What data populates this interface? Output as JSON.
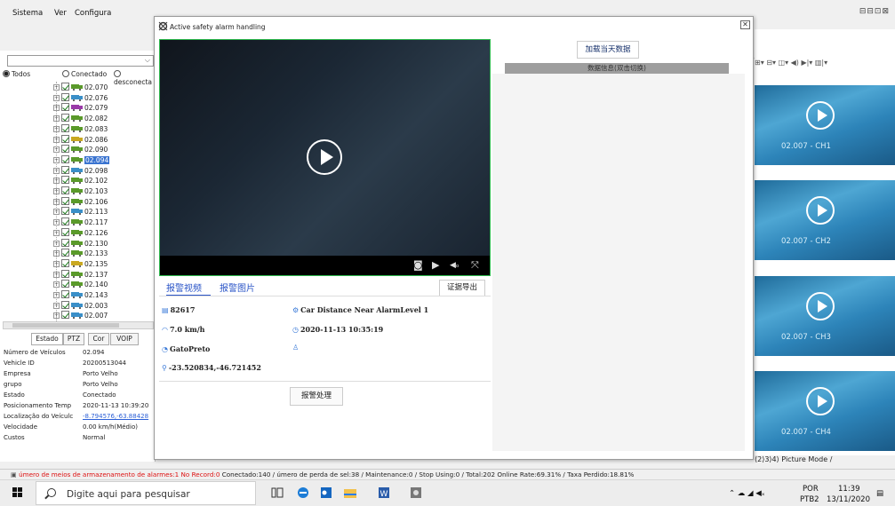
{
  "menubar": {
    "items": [
      "Sistema",
      "Ver",
      "Configura"
    ]
  },
  "filter": {
    "radio_all": "Todos",
    "radio_connected": "Conectado",
    "radio_disconnected": "desconecta"
  },
  "tree": {
    "items": [
      {
        "label": "02.070",
        "color": "#5a9a2a"
      },
      {
        "label": "02.076",
        "color": "#3a8fc8"
      },
      {
        "label": "02.079",
        "color": "#9a3aa8"
      },
      {
        "label": "02.082",
        "color": "#5a9a2a"
      },
      {
        "label": "02.083",
        "color": "#5a9a2a"
      },
      {
        "label": "02.086",
        "color": "#c9a820"
      },
      {
        "label": "02.090",
        "color": "#5a9a2a"
      },
      {
        "label": "02.094",
        "color": "#5a9a2a",
        "selected": true
      },
      {
        "label": "02.098",
        "color": "#3a8fc8"
      },
      {
        "label": "02.102",
        "color": "#5a9a2a"
      },
      {
        "label": "02.103",
        "color": "#5a9a2a"
      },
      {
        "label": "02.106",
        "color": "#5a9a2a"
      },
      {
        "label": "02.113",
        "color": "#3a8fc8"
      },
      {
        "label": "02.117",
        "color": "#5a9a2a"
      },
      {
        "label": "02.126",
        "color": "#5a9a2a"
      },
      {
        "label": "02.130",
        "color": "#5a9a2a"
      },
      {
        "label": "02.133",
        "color": "#5a9a2a"
      },
      {
        "label": "02.135",
        "color": "#c9a820"
      },
      {
        "label": "02.137",
        "color": "#5a9a2a"
      },
      {
        "label": "02.140",
        "color": "#5a9a2a"
      },
      {
        "label": "02.143",
        "color": "#3a8fc8"
      },
      {
        "label": "02.003",
        "color": "#3a8fc8"
      },
      {
        "label": "02.007",
        "color": "#3a8fc8"
      }
    ]
  },
  "tabs": [
    "Estado",
    "PTZ",
    "Cor",
    "VOIP"
  ],
  "props": [
    {
      "k": "Número de Veículos",
      "v": "02.094"
    },
    {
      "k": "Vehicle ID",
      "v": "20200513044"
    },
    {
      "k": "Empresa",
      "v": "Porto Velho"
    },
    {
      "k": "grupo",
      "v": "Porto Velho"
    },
    {
      "k": "Estado",
      "v": "Conectado"
    },
    {
      "k": "Posicionamento Temp",
      "v": "2020-11-13 10:39:20"
    },
    {
      "k": "Localização do Veículc",
      "v": "-8.794576,-63.88428"
    },
    {
      "k": "Velocidade",
      "v": "0.00 km/h(Médio)"
    },
    {
      "k": "Custos",
      "v": "Normal"
    }
  ],
  "dialog": {
    "title": "Active safety alarm handling",
    "tab_video": "报警视频",
    "tab_image": "报警图片",
    "export": "证据导出",
    "plate": "82617",
    "alarm": "Car Distance Near AlarmLevel 1",
    "speed": "7.0 km/h",
    "time": "2020-11-13 10:35:19",
    "driver": "GatoPreto",
    "coords": "-23.520834,-46.721452",
    "handle": "报警处理",
    "load_today": "加载当天数据",
    "data_header": "数据信息(双击切换)"
  },
  "channels": [
    "02.007 - CH1",
    "02.007 - CH2",
    "02.007 - CH3",
    "02.007 - CH4"
  ],
  "pager": "⟨2⟩3⟩4⟩ Picture Mode /",
  "status": {
    "red": "úmero de meios de armazenamento de alarmes:1   No Record:0",
    "rest": "   Conectado:140 / úmero de perda de sel:38 / Maintenance:0 / Stop Using:0 / Total:202   Online Rate:69.31% / Taxa Perdido:18.81%"
  },
  "taskbar": {
    "search": "Digite aqui para pesquisar",
    "lang1": "POR",
    "lang2": "PTB2",
    "time": "11:39",
    "date": "13/11/2020"
  }
}
